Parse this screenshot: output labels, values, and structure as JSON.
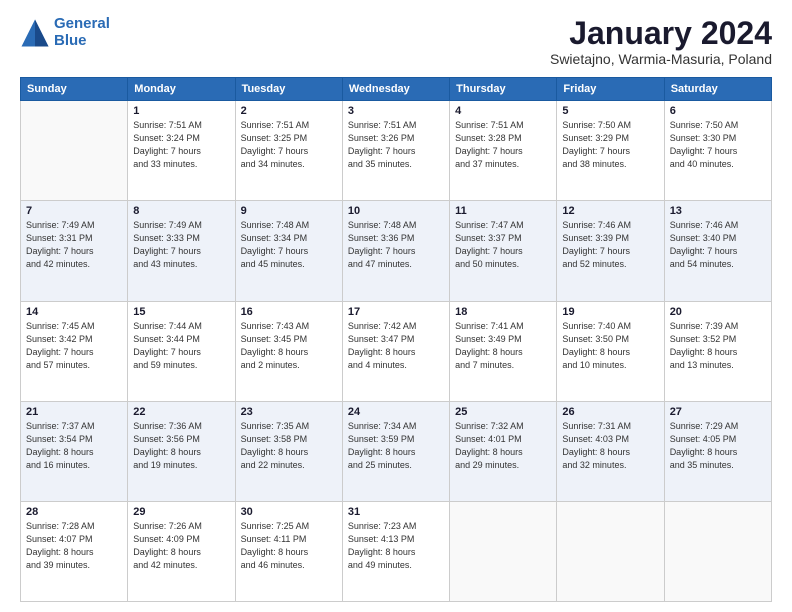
{
  "logo": {
    "line1": "General",
    "line2": "Blue"
  },
  "title": "January 2024",
  "location": "Swietajno, Warmia-Masuria, Poland",
  "headers": [
    "Sunday",
    "Monday",
    "Tuesday",
    "Wednesday",
    "Thursday",
    "Friday",
    "Saturday"
  ],
  "weeks": [
    [
      {
        "day": "",
        "info": ""
      },
      {
        "day": "1",
        "info": "Sunrise: 7:51 AM\nSunset: 3:24 PM\nDaylight: 7 hours\nand 33 minutes."
      },
      {
        "day": "2",
        "info": "Sunrise: 7:51 AM\nSunset: 3:25 PM\nDaylight: 7 hours\nand 34 minutes."
      },
      {
        "day": "3",
        "info": "Sunrise: 7:51 AM\nSunset: 3:26 PM\nDaylight: 7 hours\nand 35 minutes."
      },
      {
        "day": "4",
        "info": "Sunrise: 7:51 AM\nSunset: 3:28 PM\nDaylight: 7 hours\nand 37 minutes."
      },
      {
        "day": "5",
        "info": "Sunrise: 7:50 AM\nSunset: 3:29 PM\nDaylight: 7 hours\nand 38 minutes."
      },
      {
        "day": "6",
        "info": "Sunrise: 7:50 AM\nSunset: 3:30 PM\nDaylight: 7 hours\nand 40 minutes."
      }
    ],
    [
      {
        "day": "7",
        "info": "Sunrise: 7:49 AM\nSunset: 3:31 PM\nDaylight: 7 hours\nand 42 minutes."
      },
      {
        "day": "8",
        "info": "Sunrise: 7:49 AM\nSunset: 3:33 PM\nDaylight: 7 hours\nand 43 minutes."
      },
      {
        "day": "9",
        "info": "Sunrise: 7:48 AM\nSunset: 3:34 PM\nDaylight: 7 hours\nand 45 minutes."
      },
      {
        "day": "10",
        "info": "Sunrise: 7:48 AM\nSunset: 3:36 PM\nDaylight: 7 hours\nand 47 minutes."
      },
      {
        "day": "11",
        "info": "Sunrise: 7:47 AM\nSunset: 3:37 PM\nDaylight: 7 hours\nand 50 minutes."
      },
      {
        "day": "12",
        "info": "Sunrise: 7:46 AM\nSunset: 3:39 PM\nDaylight: 7 hours\nand 52 minutes."
      },
      {
        "day": "13",
        "info": "Sunrise: 7:46 AM\nSunset: 3:40 PM\nDaylight: 7 hours\nand 54 minutes."
      }
    ],
    [
      {
        "day": "14",
        "info": "Sunrise: 7:45 AM\nSunset: 3:42 PM\nDaylight: 7 hours\nand 57 minutes."
      },
      {
        "day": "15",
        "info": "Sunrise: 7:44 AM\nSunset: 3:44 PM\nDaylight: 7 hours\nand 59 minutes."
      },
      {
        "day": "16",
        "info": "Sunrise: 7:43 AM\nSunset: 3:45 PM\nDaylight: 8 hours\nand 2 minutes."
      },
      {
        "day": "17",
        "info": "Sunrise: 7:42 AM\nSunset: 3:47 PM\nDaylight: 8 hours\nand 4 minutes."
      },
      {
        "day": "18",
        "info": "Sunrise: 7:41 AM\nSunset: 3:49 PM\nDaylight: 8 hours\nand 7 minutes."
      },
      {
        "day": "19",
        "info": "Sunrise: 7:40 AM\nSunset: 3:50 PM\nDaylight: 8 hours\nand 10 minutes."
      },
      {
        "day": "20",
        "info": "Sunrise: 7:39 AM\nSunset: 3:52 PM\nDaylight: 8 hours\nand 13 minutes."
      }
    ],
    [
      {
        "day": "21",
        "info": "Sunrise: 7:37 AM\nSunset: 3:54 PM\nDaylight: 8 hours\nand 16 minutes."
      },
      {
        "day": "22",
        "info": "Sunrise: 7:36 AM\nSunset: 3:56 PM\nDaylight: 8 hours\nand 19 minutes."
      },
      {
        "day": "23",
        "info": "Sunrise: 7:35 AM\nSunset: 3:58 PM\nDaylight: 8 hours\nand 22 minutes."
      },
      {
        "day": "24",
        "info": "Sunrise: 7:34 AM\nSunset: 3:59 PM\nDaylight: 8 hours\nand 25 minutes."
      },
      {
        "day": "25",
        "info": "Sunrise: 7:32 AM\nSunset: 4:01 PM\nDaylight: 8 hours\nand 29 minutes."
      },
      {
        "day": "26",
        "info": "Sunrise: 7:31 AM\nSunset: 4:03 PM\nDaylight: 8 hours\nand 32 minutes."
      },
      {
        "day": "27",
        "info": "Sunrise: 7:29 AM\nSunset: 4:05 PM\nDaylight: 8 hours\nand 35 minutes."
      }
    ],
    [
      {
        "day": "28",
        "info": "Sunrise: 7:28 AM\nSunset: 4:07 PM\nDaylight: 8 hours\nand 39 minutes."
      },
      {
        "day": "29",
        "info": "Sunrise: 7:26 AM\nSunset: 4:09 PM\nDaylight: 8 hours\nand 42 minutes."
      },
      {
        "day": "30",
        "info": "Sunrise: 7:25 AM\nSunset: 4:11 PM\nDaylight: 8 hours\nand 46 minutes."
      },
      {
        "day": "31",
        "info": "Sunrise: 7:23 AM\nSunset: 4:13 PM\nDaylight: 8 hours\nand 49 minutes."
      },
      {
        "day": "",
        "info": ""
      },
      {
        "day": "",
        "info": ""
      },
      {
        "day": "",
        "info": ""
      }
    ]
  ]
}
